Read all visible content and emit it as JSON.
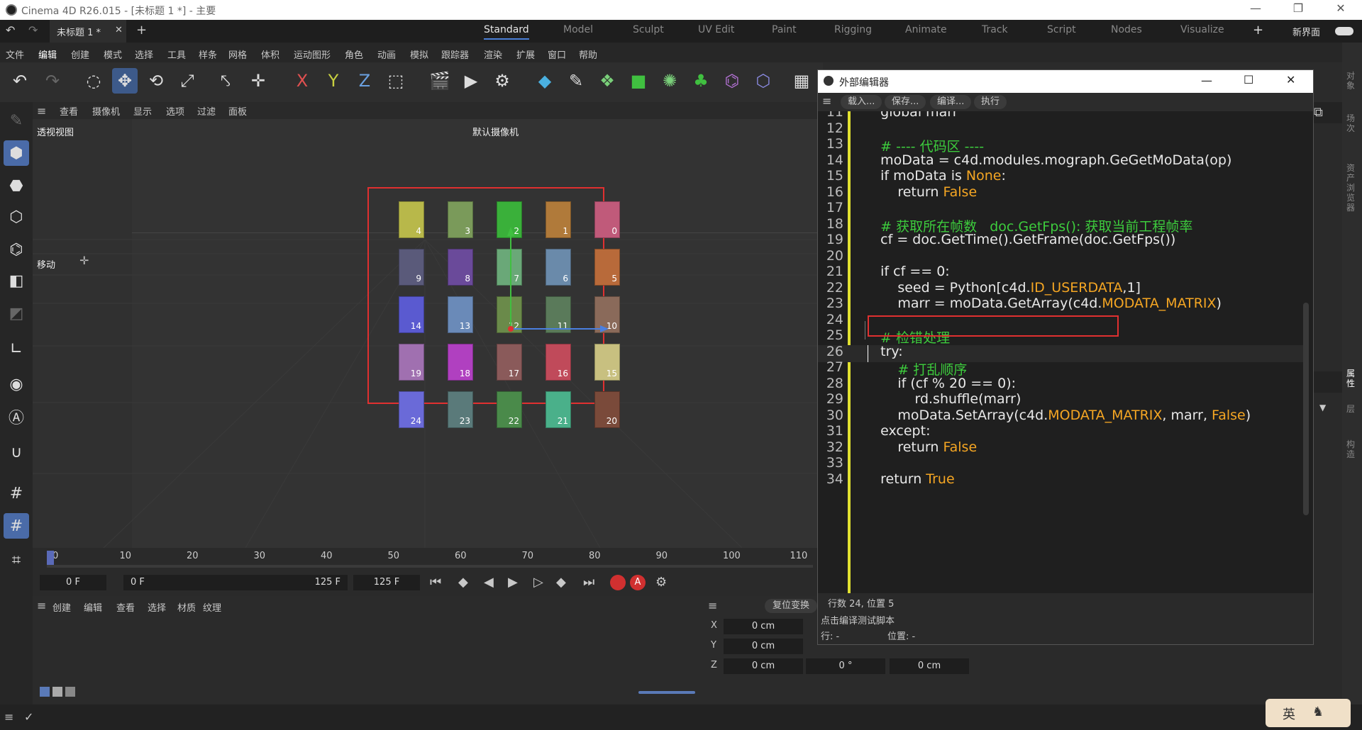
{
  "window": {
    "title": "Cinema 4D R26.015 - [未标题 1 *] - 主要"
  },
  "doc_tab": {
    "label": "未标题 1 *"
  },
  "layouts": [
    "Standard",
    "Model",
    "Sculpt",
    "UV Edit",
    "Paint",
    "Rigging",
    "Animate",
    "Track",
    "Script",
    "Nodes",
    "Visualize"
  ],
  "new_layout": "新界面",
  "menu": [
    "文件",
    "编辑",
    "创建",
    "模式",
    "选择",
    "工具",
    "样条",
    "网格",
    "体积",
    "运动图形",
    "角色",
    "动画",
    "模拟",
    "跟踪器",
    "渲染",
    "扩展",
    "窗口",
    "帮助"
  ],
  "viewport": {
    "menu": [
      "查看",
      "摄像机",
      "显示",
      "选项",
      "过滤",
      "面板"
    ],
    "label": "透视视图",
    "camera": "默认摄像机",
    "move_label": "移动"
  },
  "cubes": [
    {
      "n": "4",
      "c": "#b8b84a"
    },
    {
      "n": "9",
      "c": "#5a5a7a"
    },
    {
      "n": "14",
      "c": "#5a5ad0"
    },
    {
      "n": "19",
      "c": "#a070b0"
    },
    {
      "n": "24",
      "c": "#6a6ad8"
    },
    {
      "n": "3",
      "c": "#7a9a5a"
    },
    {
      "n": "8",
      "c": "#6a4a9a"
    },
    {
      "n": "13",
      "c": "#6a8ab8"
    },
    {
      "n": "18",
      "c": "#b040c0"
    },
    {
      "n": "23",
      "c": "#5a7a7a"
    },
    {
      "n": "2",
      "c": "#3ab03a"
    },
    {
      "n": "7",
      "c": "#6aa878"
    },
    {
      "n": "12",
      "c": "#6a8a4a"
    },
    {
      "n": "17",
      "c": "#8a5a5a"
    },
    {
      "n": "22",
      "c": "#4a8a4a"
    },
    {
      "n": "1",
      "c": "#b07a3a"
    },
    {
      "n": "6",
      "c": "#6a8aaa"
    },
    {
      "n": "11",
      "c": "#5a7a5a"
    },
    {
      "n": "16",
      "c": "#c04a5a"
    },
    {
      "n": "21",
      "c": "#4ab08a"
    },
    {
      "n": "0",
      "c": "#c05a7a"
    },
    {
      "n": "5",
      "c": "#b86a3a"
    },
    {
      "n": "10",
      "c": "#8a6a5a"
    },
    {
      "n": "15",
      "c": "#c8c080"
    },
    {
      "n": "20",
      "c": "#7a4a3a"
    }
  ],
  "timeline": {
    "ticks": [
      "0",
      "10",
      "20",
      "30",
      "40",
      "50",
      "60",
      "70",
      "80",
      "90",
      "100",
      "110"
    ],
    "current": "0 F",
    "start": "0 F",
    "end": "125 F",
    "end2": "125 F"
  },
  "materials_menu": [
    "创建",
    "编辑",
    "查看",
    "选择",
    "材质",
    "纹理"
  ],
  "coords": {
    "reset": "复位变换",
    "rows": [
      {
        "axis": "X",
        "v": "0 cm"
      },
      {
        "axis": "Y",
        "v": "0 cm"
      },
      {
        "axis": "Z",
        "v": "0 cm"
      }
    ],
    "rot": "0 °",
    "rot_partial": "0",
    "size": "0 cm"
  },
  "editor": {
    "title": "外部编辑器",
    "buttons": [
      "载入...",
      "保存...",
      "编译...",
      "执行"
    ],
    "status": "行数 24, 位置 5",
    "hint": "点击编译测试脚本",
    "row_label": "行: -",
    "pos_label": "位置: -",
    "lines": [
      {
        "n": "11",
        "t": "    global marr"
      },
      {
        "n": "12",
        "t": ""
      },
      {
        "n": "13",
        "t": "    # ---- 代码区 ----"
      },
      {
        "n": "14",
        "t": "    moData = c4d.modules.mograph.GeGetMoData(op)"
      },
      {
        "n": "15",
        "t": "    if moData is None:"
      },
      {
        "n": "16",
        "t": "        return False"
      },
      {
        "n": "17",
        "t": ""
      },
      {
        "n": "18",
        "t": "    # 获取所在帧数   doc.GetFps(): 获取当前工程帧率"
      },
      {
        "n": "19",
        "t": "    cf = doc.GetTime().GetFrame(doc.GetFps())"
      },
      {
        "n": "20",
        "t": ""
      },
      {
        "n": "21",
        "t": "    if cf == 0:"
      },
      {
        "n": "22",
        "t": "        seed = Python[c4d.ID_USERDATA,1]"
      },
      {
        "n": "23",
        "t": "        marr = moData.GetArray(c4d.MODATA_MATRIX)"
      },
      {
        "n": "24",
        "t": ""
      },
      {
        "n": "25",
        "t": "    # 检错处理"
      },
      {
        "n": "26",
        "t": "    try:"
      },
      {
        "n": "27",
        "t": "        # 打乱顺序"
      },
      {
        "n": "28",
        "t": "        if (cf % 20 == 0):"
      },
      {
        "n": "29",
        "t": "            rd.shuffle(marr)"
      },
      {
        "n": "30",
        "t": "        moData.SetArray(c4d.MODATA_MATRIX, marr, False)"
      },
      {
        "n": "31",
        "t": "    except:"
      },
      {
        "n": "32",
        "t": "        return False"
      },
      {
        "n": "33",
        "t": ""
      },
      {
        "n": "34",
        "t": "    return True"
      }
    ]
  },
  "right_tabs": [
    "对象",
    "场次",
    "资产浏览器",
    "属性",
    "层",
    "构造"
  ],
  "ime": "英"
}
